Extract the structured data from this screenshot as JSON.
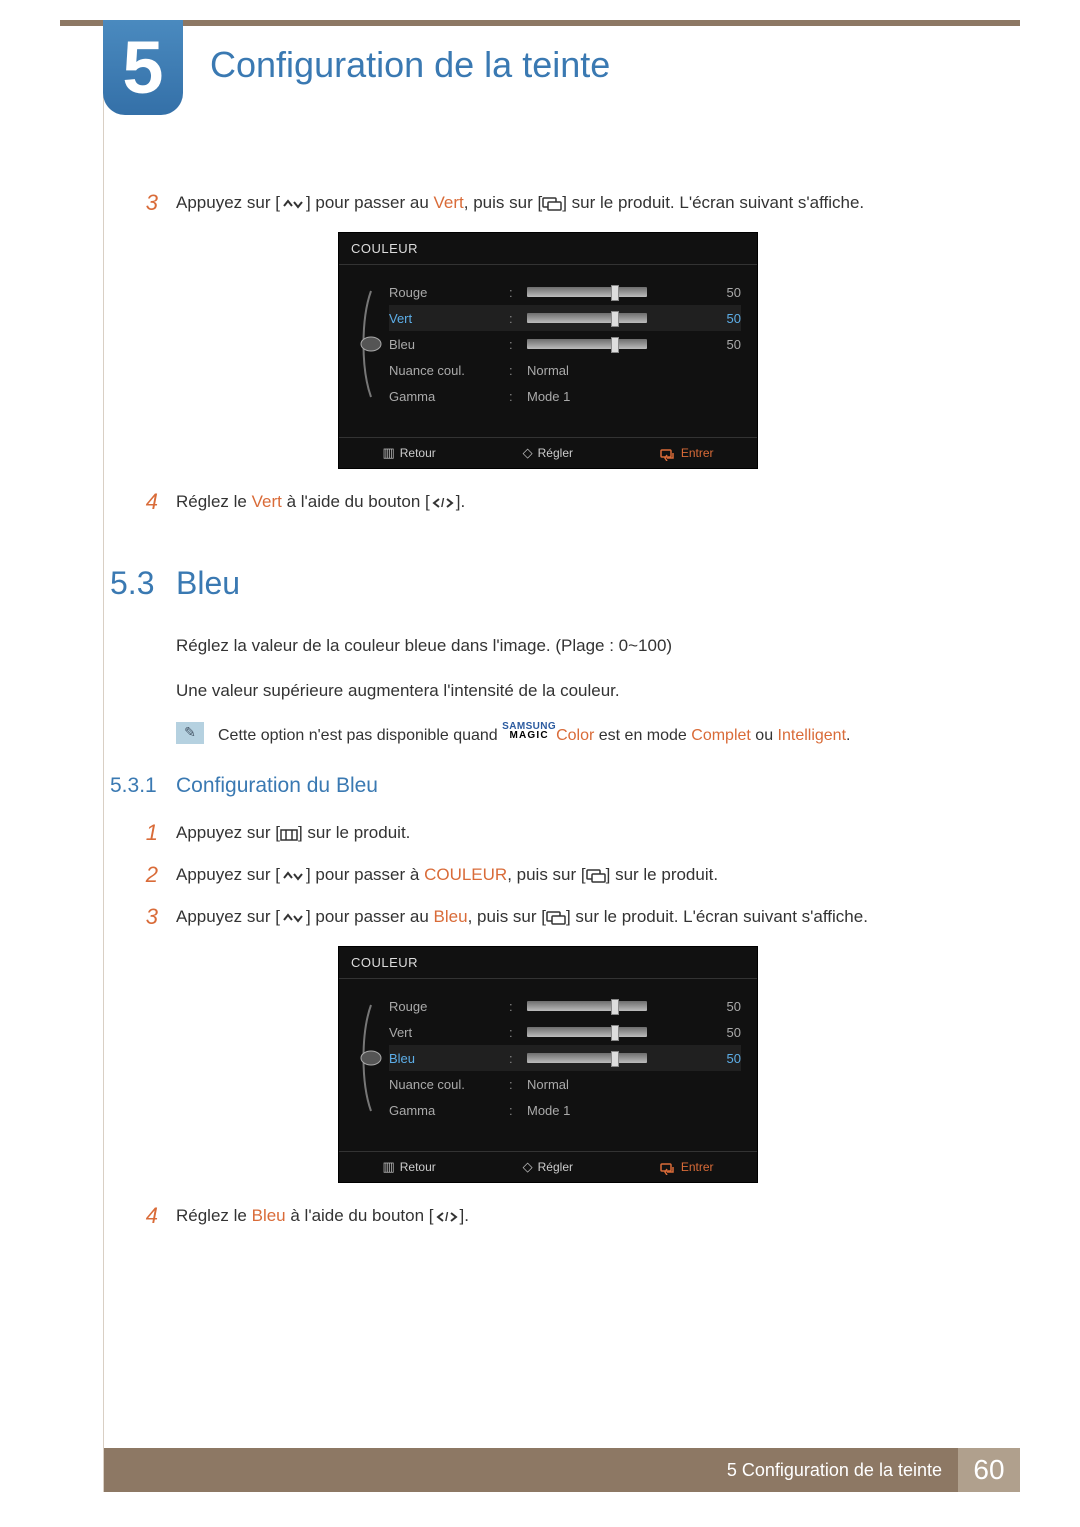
{
  "chapter": {
    "number": "5",
    "title": "Configuration de la teinte"
  },
  "top_steps": {
    "s3": {
      "num": "3",
      "pre": "Appuyez sur [",
      "mid1": "] pour passer au ",
      "kw1": "Vert",
      "mid2": ", puis sur [",
      "post": "] sur le produit. L'écran suivant s'affiche."
    },
    "s4": {
      "num": "4",
      "pre": "Réglez le ",
      "kw": "Vert",
      "mid": " à l'aide du bouton [",
      "post": "]."
    }
  },
  "osd1": {
    "title": "COULEUR",
    "rows": {
      "rouge": {
        "label": "Rouge",
        "val": "50"
      },
      "vert": {
        "label": "Vert",
        "val": "50"
      },
      "bleu": {
        "label": "Bleu",
        "val": "50"
      },
      "nuance": {
        "label": "Nuance coul.",
        "val": "Normal"
      },
      "gamma": {
        "label": "Gamma",
        "val": "Mode 1"
      }
    },
    "footer": {
      "retour": "Retour",
      "regler": "Régler",
      "entrer": "Entrer"
    }
  },
  "section": {
    "num": "5.3",
    "title": "Bleu",
    "para1": "Réglez la valeur de la couleur bleue dans l'image. (Plage : 0~100)",
    "para2": "Une valeur supérieure augmentera l'intensité de la couleur.",
    "note": {
      "pre": "Cette option n'est pas disponible quand ",
      "magic_top": "SAMSUNG",
      "magic_bot": "MAGIC",
      "color": "Color",
      "mid": " est en mode ",
      "kw1": "Complet",
      "or": " ou ",
      "kw2": "Intelligent",
      "end": "."
    }
  },
  "subsection": {
    "num": "5.3.1",
    "title": "Configuration du Bleu",
    "s1": {
      "num": "1",
      "pre": "Appuyez sur [",
      "post": "] sur le produit."
    },
    "s2": {
      "num": "2",
      "pre": "Appuyez sur [",
      "mid1": "] pour passer à ",
      "kw1": "COULEUR",
      "mid2": ", puis sur [",
      "post": "] sur le produit."
    },
    "s3": {
      "num": "3",
      "pre": "Appuyez sur [",
      "mid1": "] pour passer au ",
      "kw1": "Bleu",
      "mid2": ", puis sur [",
      "post": "] sur le produit. L'écran suivant s'affiche."
    },
    "s4": {
      "num": "4",
      "pre": "Réglez le ",
      "kw": "Bleu",
      "mid": " à l'aide du bouton [",
      "post": "]."
    }
  },
  "osd2": {
    "title": "COULEUR",
    "rows": {
      "rouge": {
        "label": "Rouge",
        "val": "50"
      },
      "vert": {
        "label": "Vert",
        "val": "50"
      },
      "bleu": {
        "label": "Bleu",
        "val": "50"
      },
      "nuance": {
        "label": "Nuance coul.",
        "val": "Normal"
      },
      "gamma": {
        "label": "Gamma",
        "val": "Mode 1"
      }
    },
    "footer": {
      "retour": "Retour",
      "regler": "Régler",
      "entrer": "Entrer"
    }
  },
  "footer": {
    "text": "5 Configuration de la teinte",
    "page": "60"
  }
}
